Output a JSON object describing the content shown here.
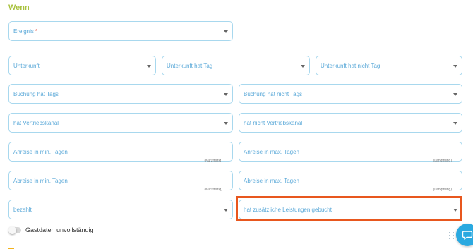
{
  "section": {
    "title": "Wenn"
  },
  "fields": {
    "ereignis": {
      "label": "Ereignis",
      "required_mark": "*"
    },
    "unterkunft": {
      "label": "Unterkunft"
    },
    "unterkunft_hat_tag": {
      "label": "Unterkunft hat Tag"
    },
    "unterkunft_hat_nicht_tag": {
      "label": "Unterkunft hat nicht Tag"
    },
    "buchung_hat_tags": {
      "label": "Buchung hat Tags"
    },
    "buchung_hat_nicht_tags": {
      "label": "Buchung hat nicht Tags"
    },
    "hat_vertriebskanal": {
      "label": "hat Vertriebskanal"
    },
    "hat_nicht_vertriebskanal": {
      "label": "hat nicht Vertriebskanal"
    },
    "anreise_min": {
      "label": "Anreise in min. Tagen",
      "hint": "(Kurzfristig)"
    },
    "anreise_max": {
      "label": "Anreise in max. Tagen",
      "hint": "(Langfristig)"
    },
    "abreise_min": {
      "label": "Abreise in min. Tagen",
      "hint": "(Kurzfristig)"
    },
    "abreise_max": {
      "label": "Abreise in max. Tagen",
      "hint": "(Langfristig)"
    },
    "bezahlt": {
      "label": "bezahlt"
    },
    "zusatzleistungen": {
      "label": "hat zusätzliche Leistungen gebucht"
    }
  },
  "toggle": {
    "label": "Gastdaten unvollständig",
    "checked": false
  },
  "icons": {
    "dropdown": "chevron-down-icon",
    "chat": "chat-icon",
    "drag": "drag-handle-icon"
  },
  "colors": {
    "section_title": "#a9c23f",
    "field_border": "#a8d8ee",
    "field_text": "#59a8d8",
    "highlight": "#e8571e",
    "chat_button": "#2aa9e0"
  }
}
